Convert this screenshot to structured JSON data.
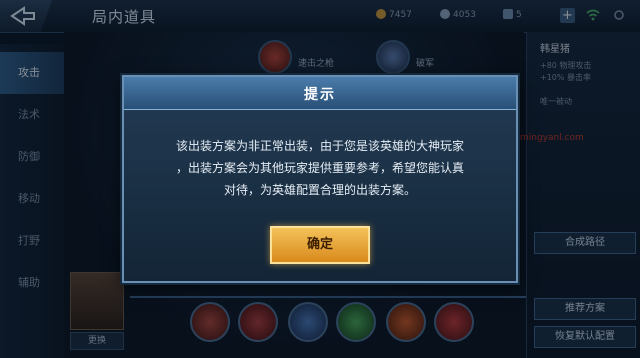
{
  "header": {
    "title": "局内道具",
    "gold": "7457",
    "coupons": "4053",
    "diamonds": "5"
  },
  "sidebar": {
    "items": [
      {
        "label": "攻击",
        "active": true
      },
      {
        "label": "法术",
        "active": false
      },
      {
        "label": "防御",
        "active": false
      },
      {
        "label": "移动",
        "active": false
      },
      {
        "label": "打野",
        "active": false
      },
      {
        "label": "辅助",
        "active": false
      }
    ]
  },
  "main": {
    "item_1": "速击之枪",
    "item_2": "破军",
    "more_label": "更换"
  },
  "right_panel": {
    "title": "韩星猪",
    "line_1": "+80 物理攻击",
    "line_2": "+10% 暴击率",
    "line_3": "唯一被动",
    "recommend_button": "推荐方案",
    "synth_button": "合成路径",
    "restore_button": "恢复默认配置"
  },
  "dialog": {
    "title": "提示",
    "message_line1": "该出装方案为非正常出装，由于您是该英雄的大神玩家",
    "message_line2": "，出装方案会为其他玩家提供重要参考，希望您能认真",
    "message_line3": "对待，为英雄配置合理的出装方案。",
    "confirm_label": "确定"
  },
  "watermark": "mingyanl.com",
  "colors": {
    "accent": "#4b7cab",
    "confirm": "#e9a838",
    "background": "#0b1826"
  }
}
